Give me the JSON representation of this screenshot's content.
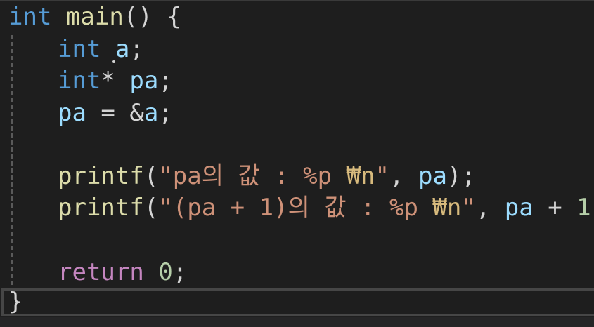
{
  "code": {
    "l1": {
      "kw": "int",
      "fn": "main",
      "p1": "()",
      "p2": " {"
    },
    "l2": {
      "kw": "int",
      "var": "a",
      "p": ";"
    },
    "l3": {
      "kw": "int",
      "star": "*",
      "var": "pa",
      "p": ";"
    },
    "l4": {
      "var1": "pa",
      "op": " = &",
      "var2": "a",
      "p": ";"
    },
    "l6": {
      "fn": "printf",
      "p1": "(",
      "str1": "\"pa의 값 : %p ",
      "esc": "₩n",
      "str2": "\"",
      "p2": ", ",
      "var": "pa",
      "p3": ");"
    },
    "l7": {
      "fn": "printf",
      "p1": "(",
      "str1": "\"(pa + 1)의 값 : %p ",
      "esc": "₩n",
      "str2": "\"",
      "p2": ", ",
      "var": "pa",
      "op": " + ",
      "num": "1",
      "p3": ");"
    },
    "l9": {
      "ctl": "return",
      "num": "0",
      "p": ";"
    },
    "l10": {
      "p": "}"
    }
  },
  "colors": {
    "background": "#1e1e1e",
    "keyword": "#569cd6",
    "function": "#dcdcaa",
    "variable": "#9cdcfe",
    "string": "#ce9178",
    "escape": "#d7ba7d",
    "number": "#b5cea8",
    "control": "#c586c0",
    "punctuation": "#d4d4d4"
  }
}
